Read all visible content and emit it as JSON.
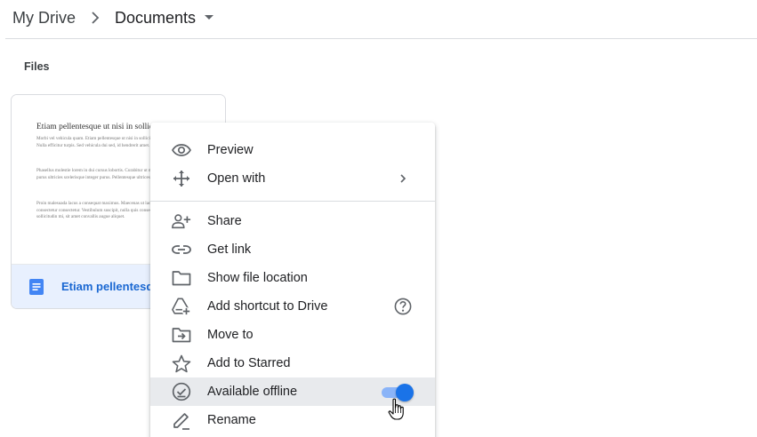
{
  "breadcrumb": {
    "root": "My Drive",
    "current": "Documents"
  },
  "section": {
    "files_label": "Files"
  },
  "file_card": {
    "thumbnail": {
      "title": "Etiam pellentesque ut nisi in sollicitudin",
      "paragraphs": [
        "Morbi vel vehicula quam. Etiam pellentesque ut nisi in sollicitudin. Nulla efficitur turpis. Sed vehicula dui sed, id hendrerit amet.",
        "Phasellus molestie lorem in dui cursus lobortis. Curabitur ut mi ac purus ultricies scelerisque integer purus. Pellentesque ultrices molestie.",
        "Proin malesuada lacus a consequat maximus. Maecenas ut lacus consectetur consectetur. Vestibulum suscipit, nulla quis consequat lorem sollicitudin mi, sit amet convallis augue aliquet."
      ]
    },
    "name": "Etiam pellentesque ut nisi in sollicitudin",
    "icon": "google-docs-icon"
  },
  "context_menu": {
    "items": [
      {
        "label": "Preview",
        "icon": "eye-icon"
      },
      {
        "label": "Open with",
        "icon": "move-arrows-icon",
        "trailing": "chevron-right-icon"
      },
      {
        "label": "Share",
        "icon": "person-add-icon"
      },
      {
        "label": "Get link",
        "icon": "link-icon"
      },
      {
        "label": "Show file location",
        "icon": "folder-icon"
      },
      {
        "label": "Add shortcut to Drive",
        "icon": "drive-shortcut-icon",
        "trailing": "help-icon"
      },
      {
        "label": "Move to",
        "icon": "move-to-folder-icon"
      },
      {
        "label": "Add to Starred",
        "icon": "star-icon"
      },
      {
        "label": "Available offline",
        "icon": "offline-check-icon",
        "toggle_on": true
      },
      {
        "label": "Rename",
        "icon": "pencil-icon"
      }
    ]
  },
  "colors": {
    "accent": "#1a73e8",
    "toggle_track": "#8ab4f8",
    "card_footer": "#e8f0fe",
    "highlight": "#e8eaed"
  }
}
